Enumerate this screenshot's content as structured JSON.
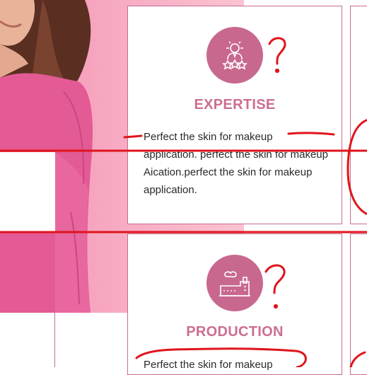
{
  "cards": [
    {
      "title": "EXPERTISE",
      "icon": "expert-award-icon",
      "body": "Perfect the skin for makeup application. perfect the skin for makeup Aication.perfect the skin for makeup application."
    },
    {
      "title": "PRODUCTION",
      "icon": "factory-icon",
      "body": "Perfect the skin for makeup"
    }
  ],
  "colors": {
    "accent": "#c8688f",
    "title": "#cc6e92",
    "border": "#c86b94",
    "annotation": "#e0141c",
    "photo_bg": "#f7a9c1"
  }
}
